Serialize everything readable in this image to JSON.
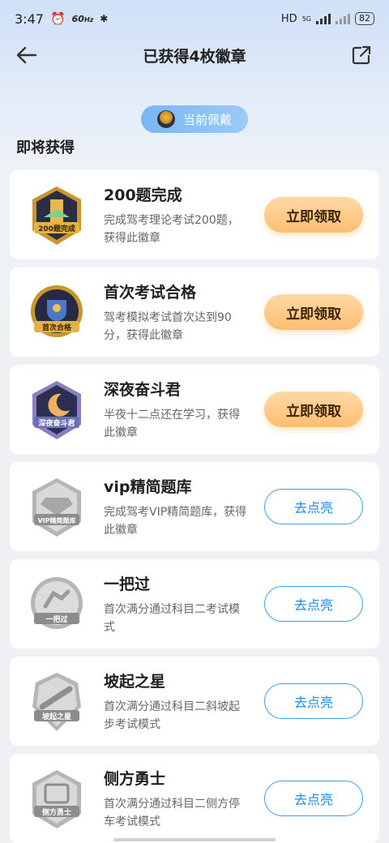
{
  "status": {
    "time": "3:47",
    "speed": "60",
    "speed_unit": "Hz",
    "network": "HD",
    "net_type": "5G",
    "battery": "82"
  },
  "header": {
    "title": "已获得4枚徽章"
  },
  "current_wearing": {
    "label": "当前佩戴"
  },
  "section": {
    "title": "即将获得"
  },
  "badges": [
    {
      "name": "200题完成",
      "desc": "完成驾考理论考试200题，获得此徽章",
      "action": "立即领取",
      "badge_text": "200题完成",
      "state": "claimable"
    },
    {
      "name": "首次考试合格",
      "desc": "驾考模拟考试首次达到90分，获得此徽章",
      "action": "立即领取",
      "badge_text": "首次合格",
      "state": "claimable"
    },
    {
      "name": "深夜奋斗君",
      "desc": "半夜十二点还在学习，获得此徽章",
      "action": "立即领取",
      "badge_text": "深夜奋斗君",
      "state": "claimable"
    },
    {
      "name": "vip精简题库",
      "desc": "完成驾考VIP精简题库，获得此徽章",
      "action": "去点亮",
      "badge_text": "VIP精简题库",
      "state": "locked"
    },
    {
      "name": "一把过",
      "desc": "首次满分通过科目二考试模式",
      "action": "去点亮",
      "badge_text": "一把过",
      "state": "locked"
    },
    {
      "name": "坡起之星",
      "desc": "首次满分通过科目二斜坡起步考试模式",
      "action": "去点亮",
      "badge_text": "坡起之星",
      "state": "locked"
    },
    {
      "name": "侧方勇士",
      "desc": "首次满分通过科目二侧方停车考试模式",
      "action": "去点亮",
      "badge_text": "侧方勇士",
      "state": "locked"
    }
  ],
  "colors": {
    "claim_button": "#ffbe72",
    "light_button_border": "#3a9ff0",
    "pill": "#79b6f3"
  }
}
